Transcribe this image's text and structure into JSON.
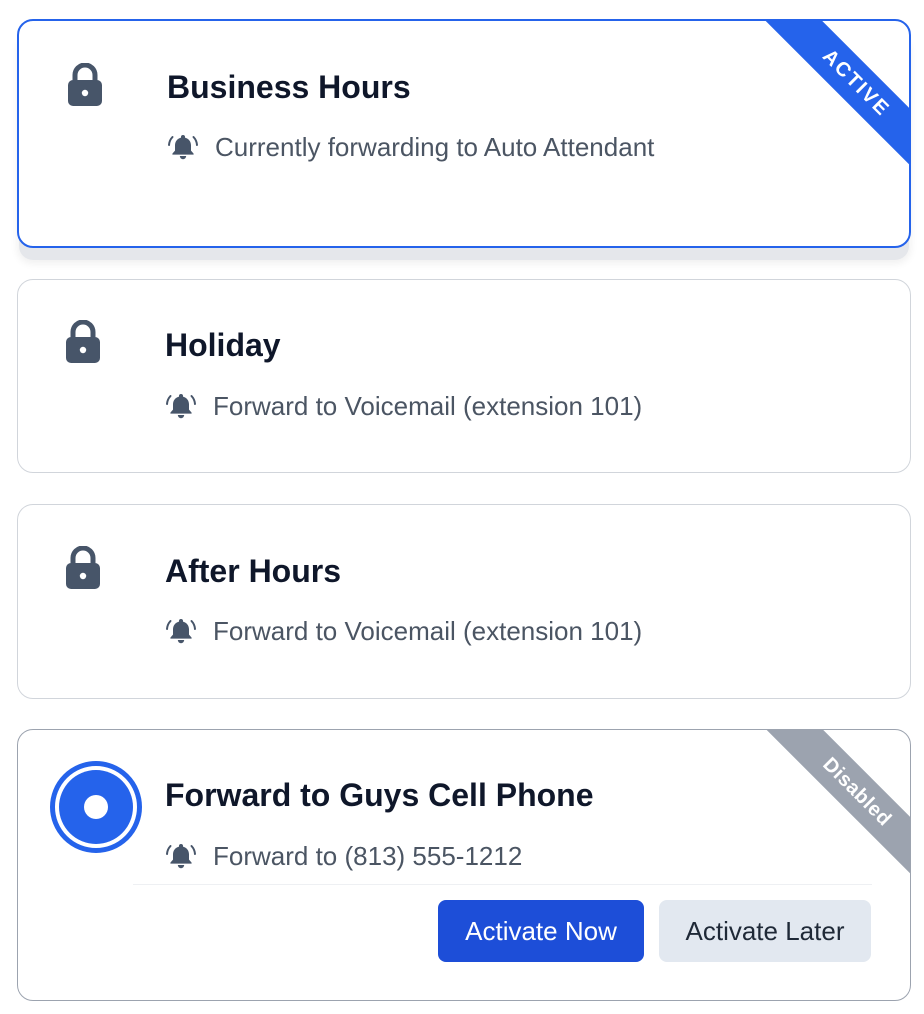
{
  "colors": {
    "accent": "#2563eb",
    "primary_button": "#1d4ed8",
    "disabled_ribbon": "#9ca3af",
    "icon": "#475569"
  },
  "cards": [
    {
      "icon": "lock-icon",
      "title": "Business Hours",
      "subtitle_icon": "bell-icon",
      "subtitle": "Currently forwarding to Auto Attendant",
      "ribbon": "ACTIVE"
    },
    {
      "icon": "lock-icon",
      "title": "Holiday",
      "subtitle_icon": "bell-icon",
      "subtitle": "Forward to Voicemail (extension 101)"
    },
    {
      "icon": "lock-icon",
      "title": "After Hours",
      "subtitle_icon": "bell-icon",
      "subtitle": "Forward to Voicemail (extension 101)"
    },
    {
      "icon": "radio-selected-icon",
      "title": "Forward to Guys Cell Phone",
      "subtitle_icon": "bell-icon",
      "subtitle": "Forward to (813) 555-1212",
      "ribbon": "Disabled",
      "actions": {
        "activate_now": "Activate Now",
        "activate_later": "Activate Later"
      }
    }
  ]
}
